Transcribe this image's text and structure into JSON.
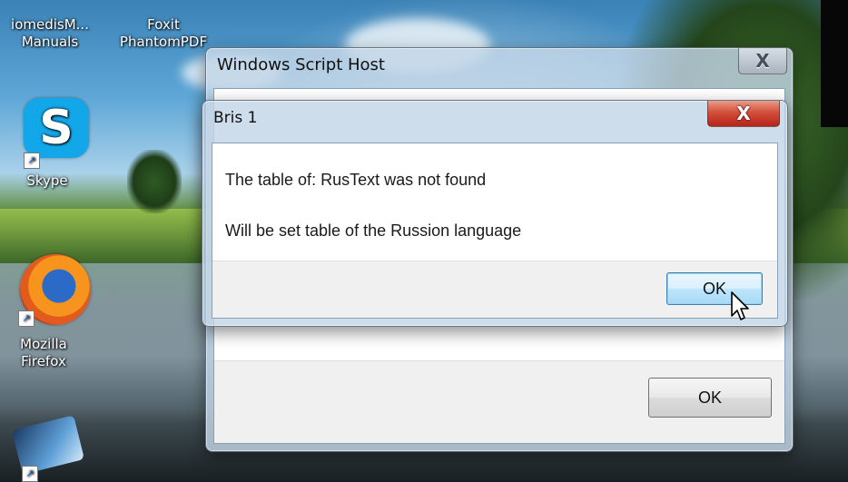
{
  "desktop": {
    "icons": [
      {
        "label_line1": "iomedisM...",
        "label_line2": "Manuals"
      },
      {
        "label_line1": "Foxit",
        "label_line2": "PhantomPDF"
      },
      {
        "label": "Skype",
        "icon": "skype-icon"
      },
      {
        "label_line1": "Mozilla",
        "label_line2": "Firefox",
        "icon": "firefox-icon"
      }
    ]
  },
  "back_dialog": {
    "title": "Windows Script Host",
    "close_symbol": "X",
    "ok_label": "OK"
  },
  "front_dialog": {
    "title": "Bris 1",
    "close_symbol": "X",
    "message_line1": "The table of: RusText was not found",
    "message_line2": "Will be set table of the Russion language",
    "ok_label": "OK"
  }
}
